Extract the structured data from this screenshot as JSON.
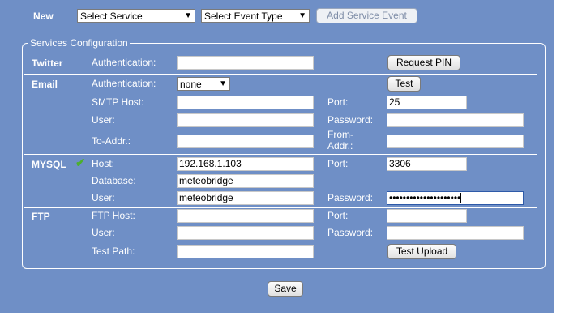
{
  "topbar": {
    "new_label": "New",
    "service_select": "Select Service",
    "event_type_select": "Select Event Type",
    "add_button": "Add Service Event"
  },
  "legend": "Services Configuration",
  "twitter": {
    "title": "Twitter",
    "auth_label": "Authentication:",
    "auth_value": "",
    "request_pin": "Request PIN"
  },
  "email": {
    "title": "Email",
    "auth_label": "Authentication:",
    "auth_value": "none",
    "test_button": "Test",
    "smtp_label": "SMTP Host:",
    "smtp_value": "",
    "port_label": "Port:",
    "port_value": "25",
    "user_label": "User:",
    "user_value": "",
    "password_label": "Password:",
    "password_value": "",
    "to_label": "To-Addr.:",
    "to_value": "",
    "from_label_1": "From-",
    "from_label_2": "Addr.:",
    "from_value": ""
  },
  "mysql": {
    "title": "MYSQL",
    "status_icon": "check-icon",
    "status_color": "#4caf2e",
    "check_glyph": "✔",
    "host_label": "Host:",
    "host_value": "192.168.1.103",
    "port_label": "Port:",
    "port_value": "3306",
    "db_label": "Database:",
    "db_value": "meteobridge",
    "user_label": "User:",
    "user_value": "meteobridge",
    "password_label": "Password:",
    "password_value": "•••••••••••••••••••••"
  },
  "ftp": {
    "title": "FTP",
    "host_label": "FTP Host:",
    "host_value": "",
    "port_label": "Port:",
    "port_value": "",
    "user_label": "User:",
    "user_value": "",
    "password_label": "Password:",
    "password_value": "",
    "path_label": "Test Path:",
    "path_value": "",
    "test_upload": "Test Upload"
  },
  "save_button": "Save"
}
